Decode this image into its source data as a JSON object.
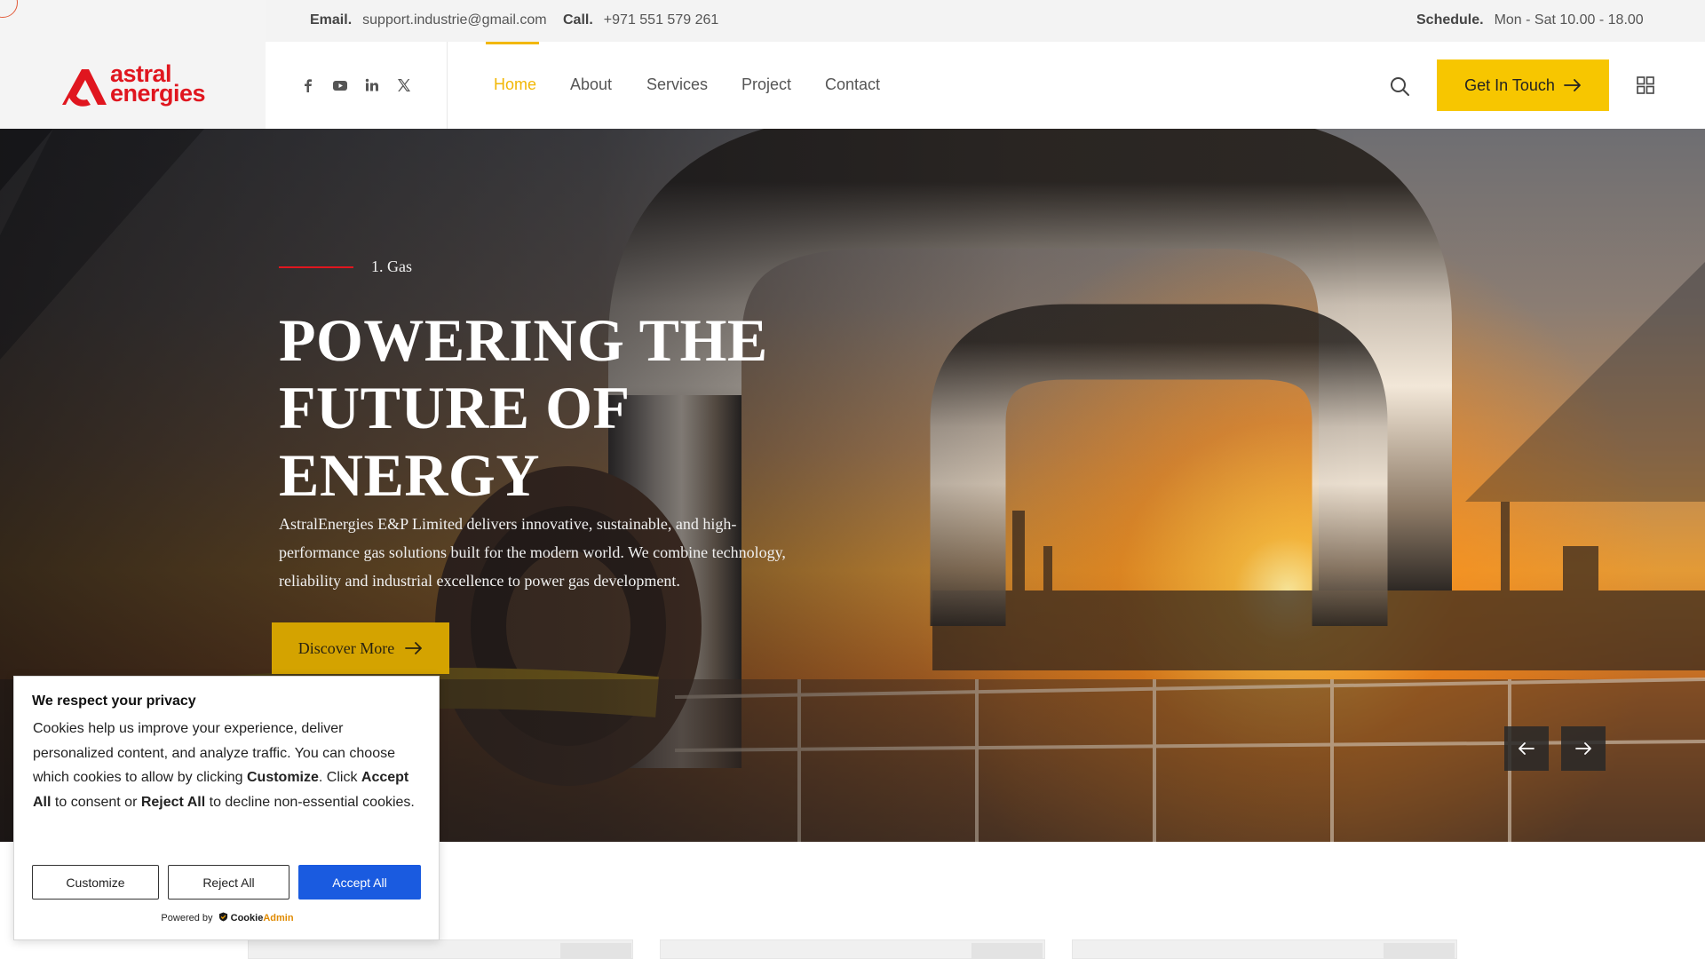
{
  "topbar": {
    "email_label": "Email.",
    "email_value": "support.industrie@gmail.com",
    "call_label": "Call.",
    "call_value": "+971 551 579 261",
    "schedule_label": "Schedule.",
    "schedule_value": "Mon - Sat 10.00 - 18.00"
  },
  "logo": {
    "line1": "astral",
    "line2": "energies"
  },
  "social": [
    "facebook-icon",
    "youtube-icon",
    "linkedin-icon",
    "x-icon"
  ],
  "nav": {
    "items": [
      "Home",
      "About",
      "Services",
      "Project",
      "Contact"
    ],
    "active": "Home"
  },
  "header": {
    "cta_label": "Get In Touch"
  },
  "hero": {
    "eyebrow": "1. Gas",
    "title": "POWERING THE FUTURE OF ENERGY",
    "description": "AstralEnergies E&P Limited delivers innovative, sustainable, and high-performance gas solutions built for the modern world. We combine technology, reliability and industrial excellence to power gas development.",
    "button_label": "Discover More"
  },
  "cookie": {
    "title": "We respect your privacy",
    "text_1": "Cookies help us improve your experience, deliver personalized content, and analyze traffic. You can choose which cookies to allow by clicking ",
    "text_customize": "Customize",
    "text_2": ". Click ",
    "text_accept": "Accept All",
    "text_3": " to consent or ",
    "text_reject": "Reject All",
    "text_4": " to decline non-essential cookies.",
    "customize_label": "Customize",
    "reject_label": "Reject All",
    "accept_label": "Accept All",
    "powered_by": "Powered by",
    "brand_1": "Cookie",
    "brand_2": "Admin"
  },
  "colors": {
    "accent_yellow": "#f7c600",
    "brand_red": "#e0161f",
    "cookie_blue": "#1a5be0"
  }
}
